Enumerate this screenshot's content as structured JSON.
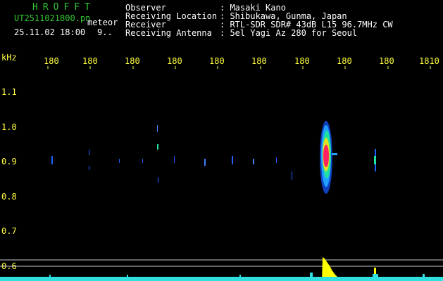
{
  "header": {
    "brand": "HROFFT",
    "filename": "UT2511021800.pn",
    "mode": "meteor",
    "datetime": "25.11.02 18:00",
    "count": "9.."
  },
  "info": [
    {
      "label": "Observer",
      "value": ": Masaki Kano"
    },
    {
      "label": "Receiving Location",
      "value": ": Shibukawa, Gunma, Japan"
    },
    {
      "label": "Receiver",
      "value": ": RTL-SDR SDR# 43dB L15 96.7MHz CW"
    },
    {
      "label": "Receiving Antenna",
      "value": ": 5el Yagi Az 280 for Seoul"
    }
  ],
  "axes": {
    "y_unit": "kHz",
    "x_ticks": [
      "180",
      "180",
      "180",
      "180",
      "180",
      "180",
      "180",
      "180",
      "180",
      "1810"
    ],
    "y_ticks": [
      "1.1",
      "1.0",
      "0.9",
      "0.8",
      "0.7",
      "0.6"
    ]
  },
  "colors": {
    "text_green": "#32c832",
    "text_yellow": "#ffff3c",
    "background": "#000000",
    "grid": "#c8c8c8",
    "echo_hot": "#ff2060",
    "echo_mid": "#20e0a0",
    "echo_cool": "#2060ff",
    "histogram": "#ffff00",
    "baseline": "#30e0e0"
  }
}
